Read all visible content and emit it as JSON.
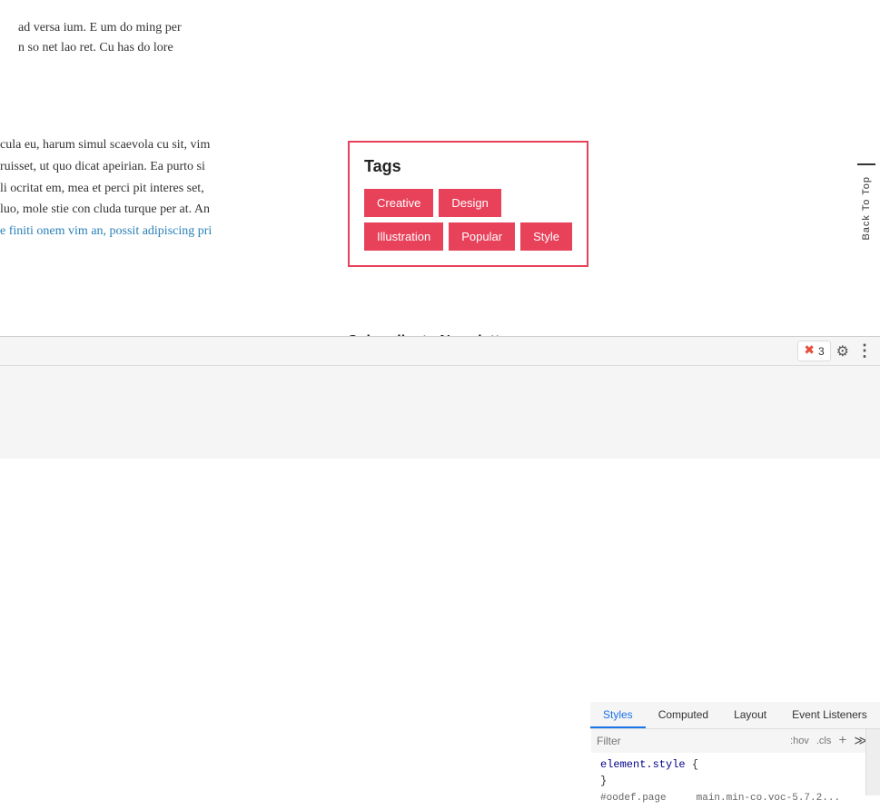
{
  "main": {
    "body_text_1": "ad versa ium. E um do ming per",
    "body_text_2": "n so net lao ret. Cu has do lore",
    "body_text_3": "cula eu, harum simul scaevola cu sit, vim",
    "body_text_4": "ruisset, ut quo dicat apeirian. Ea purto si",
    "body_text_5": "li ocritat em, mea et perci pit interes set,",
    "body_text_6": "luo, mole stie con cluda turque per at. An",
    "body_text_7": "e finiti onem vim an, possit adipiscing pri"
  },
  "tags_widget": {
    "title": "Tags",
    "tags": [
      "Creative",
      "Design",
      "Illustration",
      "Popular",
      "Style"
    ]
  },
  "back_to_top": {
    "label": "Back To Top"
  },
  "subscribe": {
    "title": "Subscribe to Newsletter"
  },
  "devtools": {
    "error_count": "3",
    "tabs": [
      "Styles",
      "Computed",
      "Layout",
      "Event Listeners"
    ],
    "active_tab": "Styles",
    "filter_placeholder": "Filter",
    "filter_hov": ":hov",
    "filter_cls": ".cls",
    "code_lines": [
      "element.style {",
      "}",
      "#oodef.page     main.min-co.voc-5.7.2..."
    ]
  }
}
